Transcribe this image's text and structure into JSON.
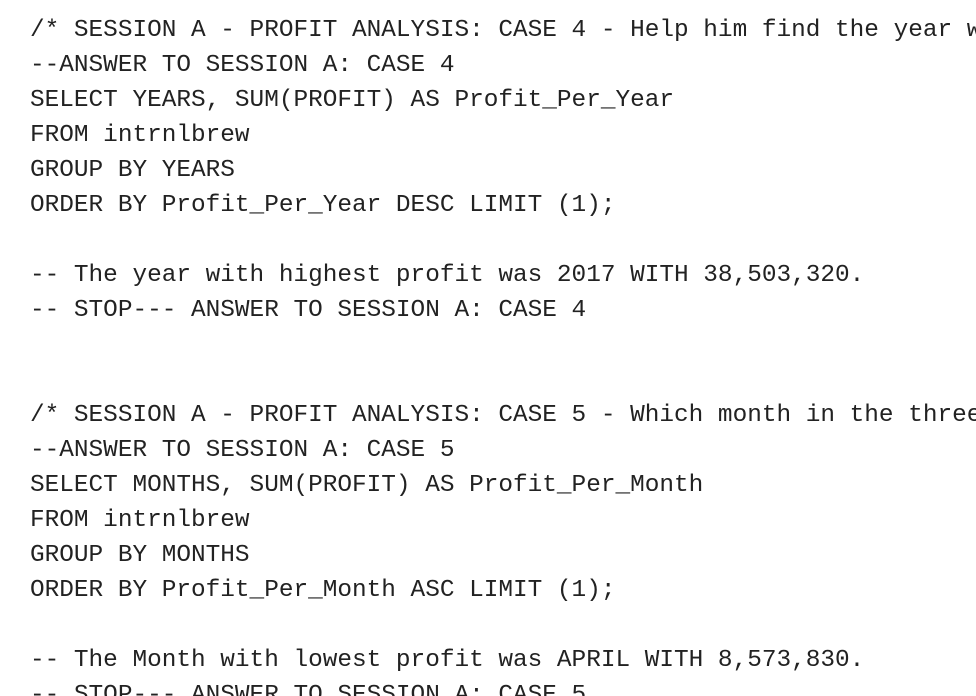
{
  "editor": {
    "lines": [
      "/* SESSION A - PROFIT ANALYSIS: CASE 4 - Help him find the year w",
      "--ANSWER TO SESSION A: CASE 4",
      "SELECT YEARS, SUM(PROFIT) AS Profit_Per_Year",
      "FROM intrnlbrew",
      "GROUP BY YEARS",
      "ORDER BY Profit_Per_Year DESC LIMIT (1);",
      "",
      "-- The year with highest profit was 2017 WITH 38,503,320.",
      "-- STOP--- ANSWER TO SESSION A: CASE 4",
      "",
      "",
      "/* SESSION A - PROFIT ANALYSIS: CASE 5 - Which month in the three",
      "--ANSWER TO SESSION A: CASE 5",
      "SELECT MONTHS, SUM(PROFIT) AS Profit_Per_Month",
      "FROM intrnlbrew",
      "GROUP BY MONTHS",
      "ORDER BY Profit_Per_Month ASC LIMIT (1);",
      "",
      "-- The Month with lowest profit was APRIL WITH 8,573,830.",
      "-- STOP--- ANSWER TO SESSION A: CASE 5"
    ]
  }
}
